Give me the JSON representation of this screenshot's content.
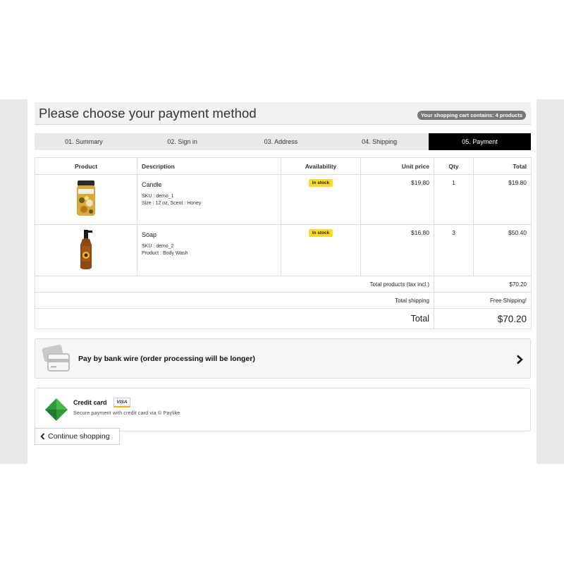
{
  "header": {
    "title": "Please choose your payment method",
    "cart_badge": "Your shopping cart contains: 4 products"
  },
  "steps": [
    {
      "label": "01. Summary",
      "current": false
    },
    {
      "label": "02. Sign in",
      "current": false
    },
    {
      "label": "03. Address",
      "current": false
    },
    {
      "label": "04. Shipping",
      "current": false
    },
    {
      "label": "05. Payment",
      "current": true
    }
  ],
  "cart_table": {
    "columns": [
      "Product",
      "Description",
      "Availability",
      "Unit price",
      "Qty",
      "Total"
    ],
    "rows": [
      {
        "name": "Candle",
        "sku": "SKU : demo_1",
        "attributes": "Size : 12 oz, Scent : Honey",
        "availability": "In stock",
        "unit_price": "$19.80",
        "qty": "1",
        "total": "$19.80",
        "image_icon": "candle-jar-icon"
      },
      {
        "name": "Soap",
        "sku": "SKU : demo_2",
        "attributes": "Product : Body Wash",
        "availability": "In stock",
        "unit_price": "$16.80",
        "qty": "3",
        "total": "$50.40",
        "image_icon": "soap-bottle-icon"
      }
    ],
    "summary": {
      "products_label": "Total products (tax incl.)",
      "products_value": "$70.20",
      "shipping_label": "Total shipping",
      "shipping_value": "Free Shipping!",
      "total_label": "Total",
      "total_value": "$70.20"
    }
  },
  "payment_options": {
    "bank_wire": {
      "label": "Pay by bank wire (order processing will be longer)",
      "icon": "credit-card-icon"
    },
    "credit_card": {
      "title": "Credit card",
      "badge": "VISA",
      "subtitle": "Secure payment with credit card via © Paylike",
      "icon": "paylike-leaf-icon"
    }
  },
  "footer": {
    "continue_label": "Continue shopping"
  },
  "colors": {
    "stock_badge": "#fcd928",
    "current_step_bg": "#000000",
    "gutter": "#e9e9e9",
    "paylike_green": "#2e9a3c"
  }
}
